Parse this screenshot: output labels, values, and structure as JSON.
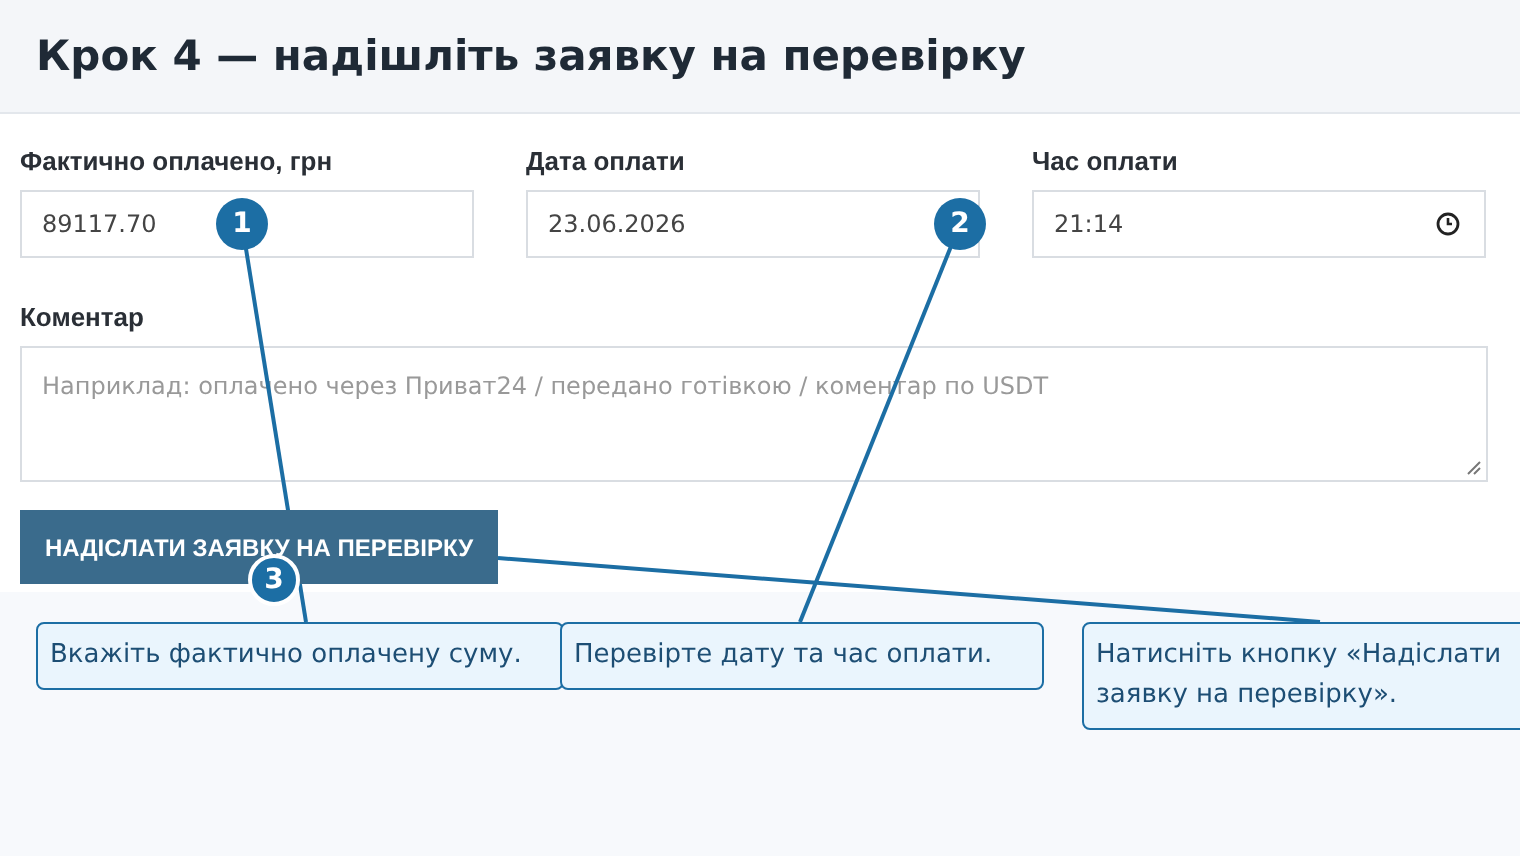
{
  "title": "Крок 4 — надішліть заявку на перевірку",
  "fields": [
    {
      "kind": "text",
      "label": "Фактично оплачено, грн",
      "value": "89117.70"
    },
    {
      "kind": "date",
      "label": "Дата оплати",
      "value": "23.06.2026"
    },
    {
      "kind": "time",
      "label": "Час оплати",
      "value": "21:14"
    }
  ],
  "comment": {
    "label": "Коментар",
    "placeholder": "Наприклад: оплачено через Приват24 / передано готівкою / коментар по USDT"
  },
  "submit_button": "НАДІСЛАТИ ЗАЯВКУ НА ПЕРЕВІРКУ",
  "markers": [
    {
      "number": "1",
      "kind": "plain"
    },
    {
      "number": "2",
      "kind": "plain"
    },
    {
      "number": "3",
      "kind": "ringed"
    }
  ],
  "callouts": [
    {
      "text": "Вкажіть фактично оплачену суму."
    },
    {
      "text": "Перевірте дату та час оплати."
    },
    {
      "text": "Натисніть кнопку «Надіслати\nзаявку на перевірку»."
    }
  ]
}
